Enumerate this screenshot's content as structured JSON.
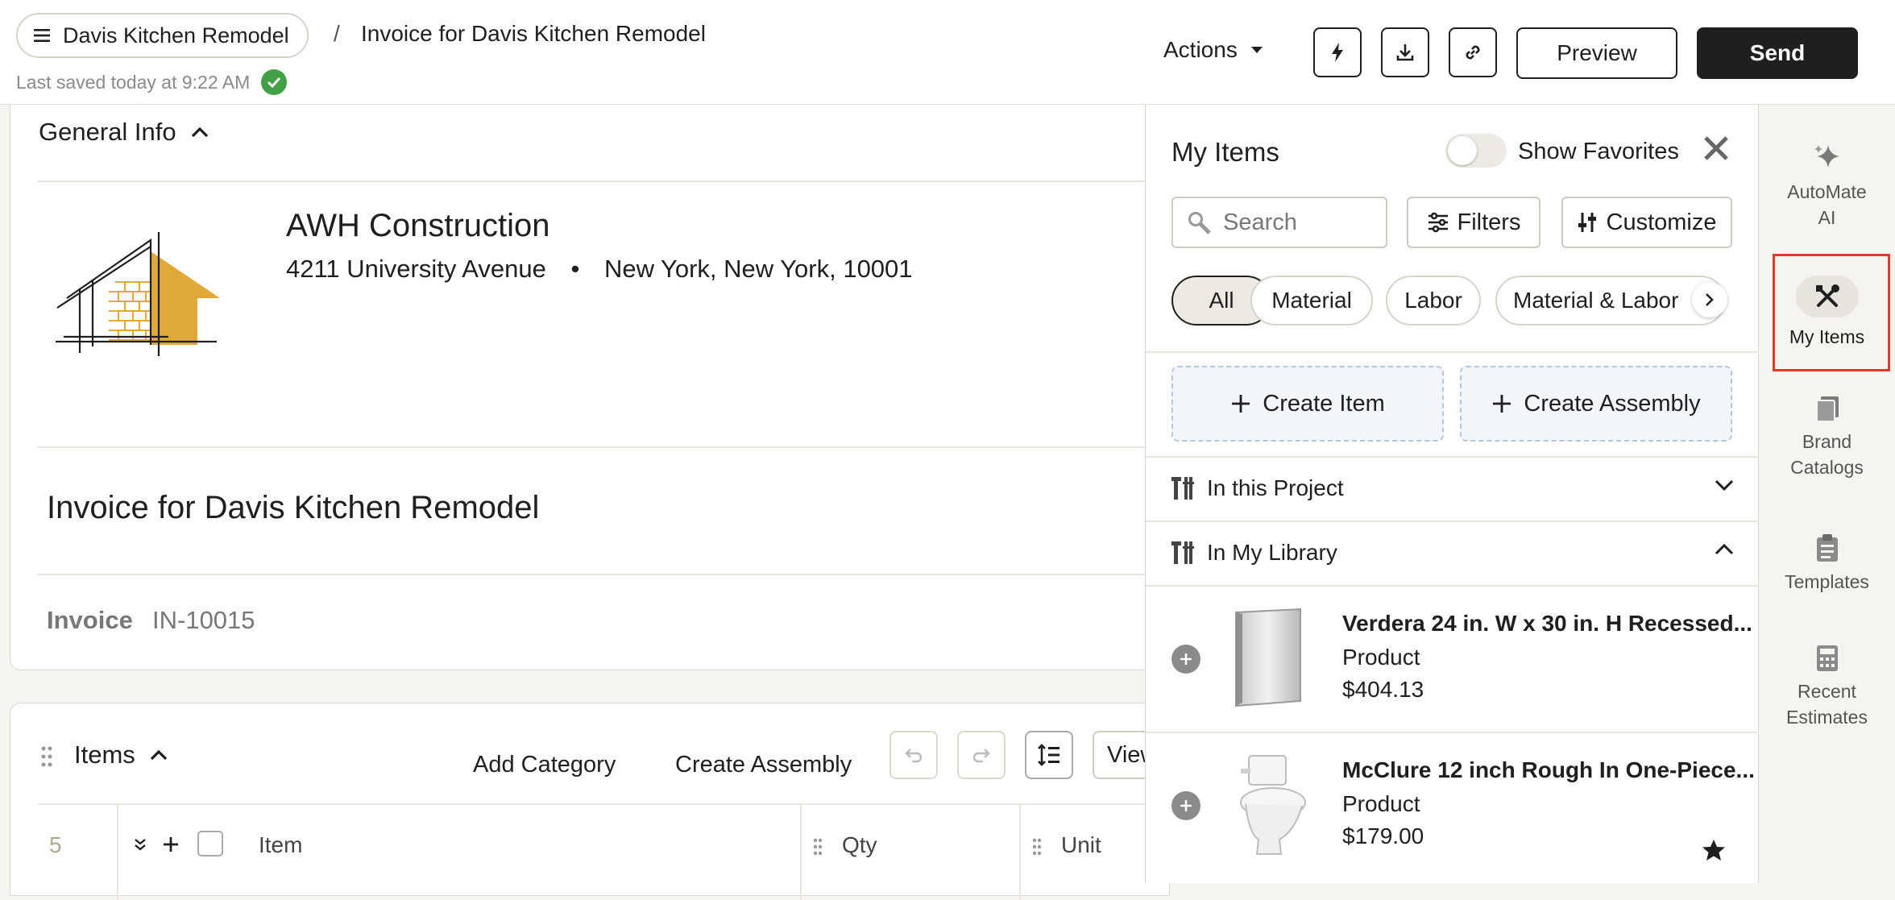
{
  "header": {
    "project_name": "Davis Kitchen Remodel",
    "separator": "/",
    "document_title": "Invoice for Davis Kitchen Remodel",
    "saved_text": "Last saved today at 9:22 AM",
    "actions_label": "Actions",
    "preview_label": "Preview",
    "send_label": "Send"
  },
  "general_info": {
    "title": "General Info",
    "company_name": "AWH Construction",
    "street": "4211 University Avenue",
    "bullet": "•",
    "city_line": "New York, New York, 10001",
    "doc_title": "Invoice for Davis Kitchen Remodel",
    "invoice_label": "Invoice",
    "invoice_number": "IN-10015"
  },
  "items_section": {
    "title": "Items",
    "add_category": "Add Category",
    "create_assembly": "Create Assembly",
    "view_label": "View",
    "row_number": "5",
    "columns": {
      "item": "Item",
      "qty": "Qty",
      "unit": "Unit"
    }
  },
  "my_items_panel": {
    "title": "My Items",
    "show_favorites": "Show Favorites",
    "search_placeholder": "Search",
    "filters_label": "Filters",
    "customize_label": "Customize",
    "chips": [
      "All",
      "Material",
      "Labor",
      "Material & Labor"
    ],
    "create_item": "Create Item",
    "create_assembly": "Create Assembly",
    "in_this_project": "In this Project",
    "in_my_library": "In My Library",
    "products": [
      {
        "name": "Verdera 24 in. W x 30 in. H Recessed...",
        "type": "Product",
        "price": "$404.13",
        "favorite": false
      },
      {
        "name": "McClure 12 inch Rough In One-Piece...",
        "type": "Product",
        "price": "$179.00",
        "favorite": true
      }
    ]
  },
  "right_rail": {
    "items": [
      {
        "label_1": "AutoMate",
        "label_2": "AI",
        "icon": "sparkle-icon"
      },
      {
        "label_1": "My Items",
        "icon": "tools-icon",
        "active": true
      },
      {
        "label_1": "Brand",
        "label_2": "Catalogs",
        "icon": "book-icon"
      },
      {
        "label_1": "Templates",
        "icon": "clipboard-icon"
      },
      {
        "label_1": "Recent",
        "label_2": "Estimates",
        "icon": "calculator-icon"
      }
    ]
  },
  "colors": {
    "accent_dark": "#1f1f1f",
    "saved_check": "#43a047",
    "logo_gold": "#e0a93a",
    "highlight_box": "#e03a2e"
  }
}
